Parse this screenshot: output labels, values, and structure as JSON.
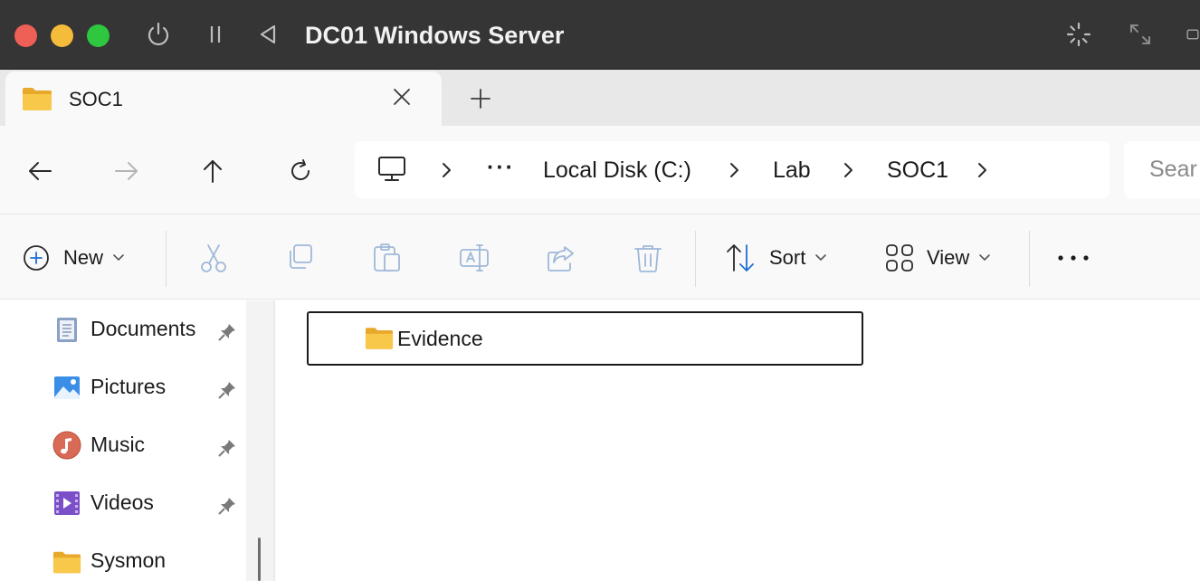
{
  "vm": {
    "title": "DC01 Windows Server",
    "controls": [
      "power-icon",
      "pause-icon",
      "back-triangle-icon"
    ],
    "right_controls": [
      "loading-spinner-icon",
      "fullscreen-icon"
    ]
  },
  "tabs": [
    {
      "label": "SOC1",
      "icon": "folder-icon",
      "active": true
    }
  ],
  "nav": {
    "back": "back-arrow-icon",
    "forward": "forward-arrow-icon",
    "up": "up-arrow-icon",
    "refresh": "refresh-icon"
  },
  "address": {
    "root_icon": "this-pc-icon",
    "overflow": "···",
    "crumbs": [
      "Local Disk (C:)",
      "Lab",
      "SOC1"
    ]
  },
  "search": {
    "placeholder": "Sear"
  },
  "toolbar": {
    "new_label": "New",
    "sort_label": "Sort",
    "view_label": "View",
    "more_label": "···",
    "disabled_actions": [
      "cut-icon",
      "copy-icon",
      "paste-icon",
      "rename-icon",
      "share-icon",
      "delete-icon"
    ]
  },
  "sidebar": {
    "items": [
      {
        "label": "Documents",
        "icon": "documents-icon",
        "pinned": true
      },
      {
        "label": "Pictures",
        "icon": "pictures-icon",
        "pinned": true
      },
      {
        "label": "Music",
        "icon": "music-icon",
        "pinned": true
      },
      {
        "label": "Videos",
        "icon": "videos-icon",
        "pinned": true
      },
      {
        "label": "Sysmon",
        "icon": "folder-icon",
        "pinned": false
      }
    ]
  },
  "content": {
    "items": [
      {
        "label": "Evidence",
        "icon": "folder-icon",
        "focused": true
      }
    ]
  },
  "colors": {
    "titlebar": "#353535",
    "close": "#ee5f56",
    "minimize": "#f5bb3a",
    "maximize": "#2fc740",
    "folder": "#f8c84a"
  }
}
